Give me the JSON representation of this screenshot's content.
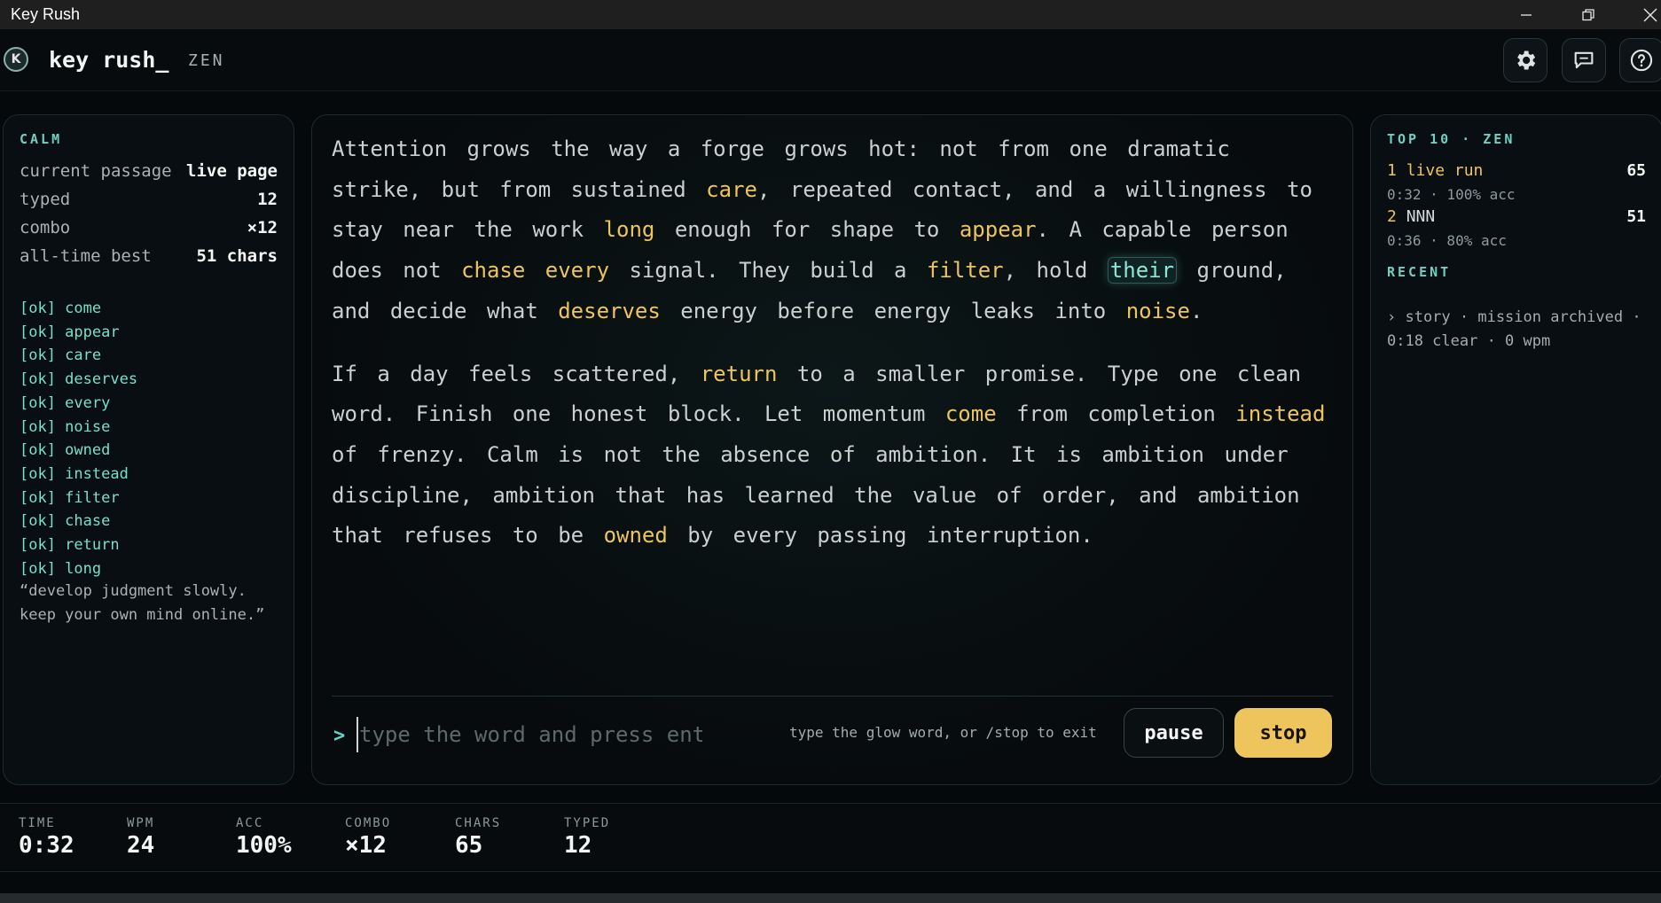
{
  "window": {
    "title": "Key Rush",
    "min_icon": "minimize-icon",
    "max_icon": "restore-icon",
    "close_icon": "close-icon"
  },
  "header": {
    "logo_text": "K",
    "app_name": "key rush_",
    "mode": "ZEN",
    "buttons": [
      "settings-icon",
      "chat-icon",
      "help-icon"
    ]
  },
  "left": {
    "section": "CALM",
    "stats": [
      {
        "label": "current passage",
        "value": "live page"
      },
      {
        "label": "typed",
        "value": "12"
      },
      {
        "label": "combo",
        "value": "×12"
      },
      {
        "label": "all-time best",
        "value": "51 chars"
      }
    ],
    "log": [
      "[ok] come",
      "[ok] appear",
      "[ok] care",
      "[ok] deserves",
      "[ok] every",
      "[ok] noise",
      "[ok] owned",
      "[ok] instead",
      "[ok] filter",
      "[ok] chase",
      "[ok] return",
      "[ok] long"
    ],
    "quote": "“develop judgment slowly. keep your own mind online.”"
  },
  "passage": {
    "paragraphs": [
      [
        [
          "Attention",
          "p"
        ],
        [
          "grows",
          "p"
        ],
        [
          "the",
          "p"
        ],
        [
          "way",
          "p"
        ],
        [
          "a",
          "p"
        ],
        [
          "forge",
          "p"
        ],
        [
          "grows",
          "p"
        ],
        [
          "hot:",
          "p"
        ],
        [
          "not",
          "p"
        ],
        [
          "from",
          "p"
        ],
        [
          "one",
          "p"
        ],
        [
          "dramatic",
          "p"
        ],
        [
          "strike,",
          "p"
        ],
        [
          "but",
          "p"
        ],
        [
          "from",
          "p"
        ],
        [
          "sustained",
          "p"
        ],
        [
          "care",
          "d"
        ],
        [
          ",",
          "p"
        ],
        [
          "repeated",
          "p"
        ],
        [
          "contact,",
          "p"
        ],
        [
          "and",
          "p"
        ],
        [
          "a",
          "p"
        ],
        [
          "willingness",
          "p"
        ],
        [
          "to",
          "p"
        ],
        [
          "stay",
          "p"
        ],
        [
          "near",
          "p"
        ],
        [
          "the",
          "p"
        ],
        [
          "work",
          "p"
        ],
        [
          "long",
          "d"
        ],
        [
          "enough",
          "p"
        ],
        [
          "for",
          "p"
        ],
        [
          "shape",
          "p"
        ],
        [
          "to",
          "p"
        ],
        [
          "appear",
          "d"
        ],
        [
          ".",
          "p"
        ],
        [
          "A",
          "p"
        ],
        [
          "capable",
          "p"
        ],
        [
          "person",
          "p"
        ],
        [
          "does",
          "p"
        ],
        [
          "not",
          "p"
        ],
        [
          "chase",
          "d"
        ],
        [
          "every",
          "d"
        ],
        [
          "signal.",
          "p"
        ],
        [
          "They",
          "p"
        ],
        [
          "build",
          "p"
        ],
        [
          "a",
          "p"
        ],
        [
          "filter",
          "d"
        ],
        [
          ",",
          "p"
        ],
        [
          "hold",
          "p"
        ],
        [
          "their",
          "c"
        ],
        [
          "ground,",
          "p"
        ],
        [
          "and",
          "p"
        ],
        [
          "decide",
          "p"
        ],
        [
          "what",
          "p"
        ],
        [
          "deserves",
          "d"
        ],
        [
          "energy",
          "p"
        ],
        [
          "before",
          "p"
        ],
        [
          "energy",
          "p"
        ],
        [
          "leaks",
          "p"
        ],
        [
          "into",
          "p"
        ],
        [
          "noise",
          "d"
        ],
        [
          ".",
          "p"
        ]
      ],
      [
        [
          "If",
          "p"
        ],
        [
          "a",
          "p"
        ],
        [
          "day",
          "p"
        ],
        [
          "feels",
          "p"
        ],
        [
          "scattered,",
          "p"
        ],
        [
          "return",
          "d"
        ],
        [
          "to",
          "p"
        ],
        [
          "a",
          "p"
        ],
        [
          "smaller",
          "p"
        ],
        [
          "promise.",
          "p"
        ],
        [
          "Type",
          "p"
        ],
        [
          "one",
          "p"
        ],
        [
          "clean",
          "p"
        ],
        [
          "word.",
          "p"
        ],
        [
          "Finish",
          "p"
        ],
        [
          "one",
          "p"
        ],
        [
          "honest",
          "p"
        ],
        [
          "block.",
          "p"
        ],
        [
          "Let",
          "p"
        ],
        [
          "momentum",
          "p"
        ],
        [
          "come",
          "d"
        ],
        [
          "from",
          "p"
        ],
        [
          "completion",
          "p"
        ],
        [
          "instead",
          "d"
        ],
        [
          "of",
          "p"
        ],
        [
          "frenzy.",
          "p"
        ],
        [
          "Calm",
          "p"
        ],
        [
          "is",
          "p"
        ],
        [
          "not",
          "p"
        ],
        [
          "the",
          "p"
        ],
        [
          "absence",
          "p"
        ],
        [
          "of",
          "p"
        ],
        [
          "ambition.",
          "p"
        ],
        [
          "It",
          "p"
        ],
        [
          "is",
          "p"
        ],
        [
          "ambition",
          "p"
        ],
        [
          "under",
          "p"
        ],
        [
          "discipline,",
          "p"
        ],
        [
          "ambition",
          "p"
        ],
        [
          "that",
          "p"
        ],
        [
          "has",
          "p"
        ],
        [
          "learned",
          "p"
        ],
        [
          "the",
          "p"
        ],
        [
          "value",
          "p"
        ],
        [
          "of",
          "p"
        ],
        [
          "order,",
          "p"
        ],
        [
          "and",
          "p"
        ],
        [
          "ambition",
          "p"
        ],
        [
          "that",
          "p"
        ],
        [
          "refuses",
          "p"
        ],
        [
          "to",
          "p"
        ],
        [
          "be",
          "p"
        ],
        [
          "owned",
          "d"
        ],
        [
          "by",
          "p"
        ],
        [
          "every",
          "p"
        ],
        [
          "passing",
          "p"
        ],
        [
          "interruption.",
          "p"
        ]
      ]
    ]
  },
  "input": {
    "prompt": ">",
    "placeholder": "type the word and press enter",
    "value": "",
    "hint": "type the glow word, or /stop to exit",
    "pause_label": "pause",
    "stop_label": "stop"
  },
  "right": {
    "leaderboard_title": "TOP 10 · ZEN",
    "leaderboard": [
      {
        "rank": "1",
        "name": "live run",
        "score": "65",
        "meta": "0:32 · 100% acc"
      },
      {
        "rank": "2",
        "name": "NNN",
        "score": "51",
        "meta": "0:36 · 80% acc"
      }
    ],
    "recent_title": "RECENT",
    "recent": "› story · mission archived · 0:18 clear · 0 wpm"
  },
  "footer": {
    "stats": [
      {
        "label": "TIME",
        "value": "0:32"
      },
      {
        "label": "WPM",
        "value": "24"
      },
      {
        "label": "ACC",
        "value": "100%"
      },
      {
        "label": "COMBO",
        "value": "×12"
      },
      {
        "label": "CHARS",
        "value": "65"
      },
      {
        "label": "TYPED",
        "value": "12"
      }
    ]
  },
  "colors": {
    "accent_gold": "#eec45c",
    "accent_teal": "#6fd0c0",
    "background": "#05090b"
  }
}
